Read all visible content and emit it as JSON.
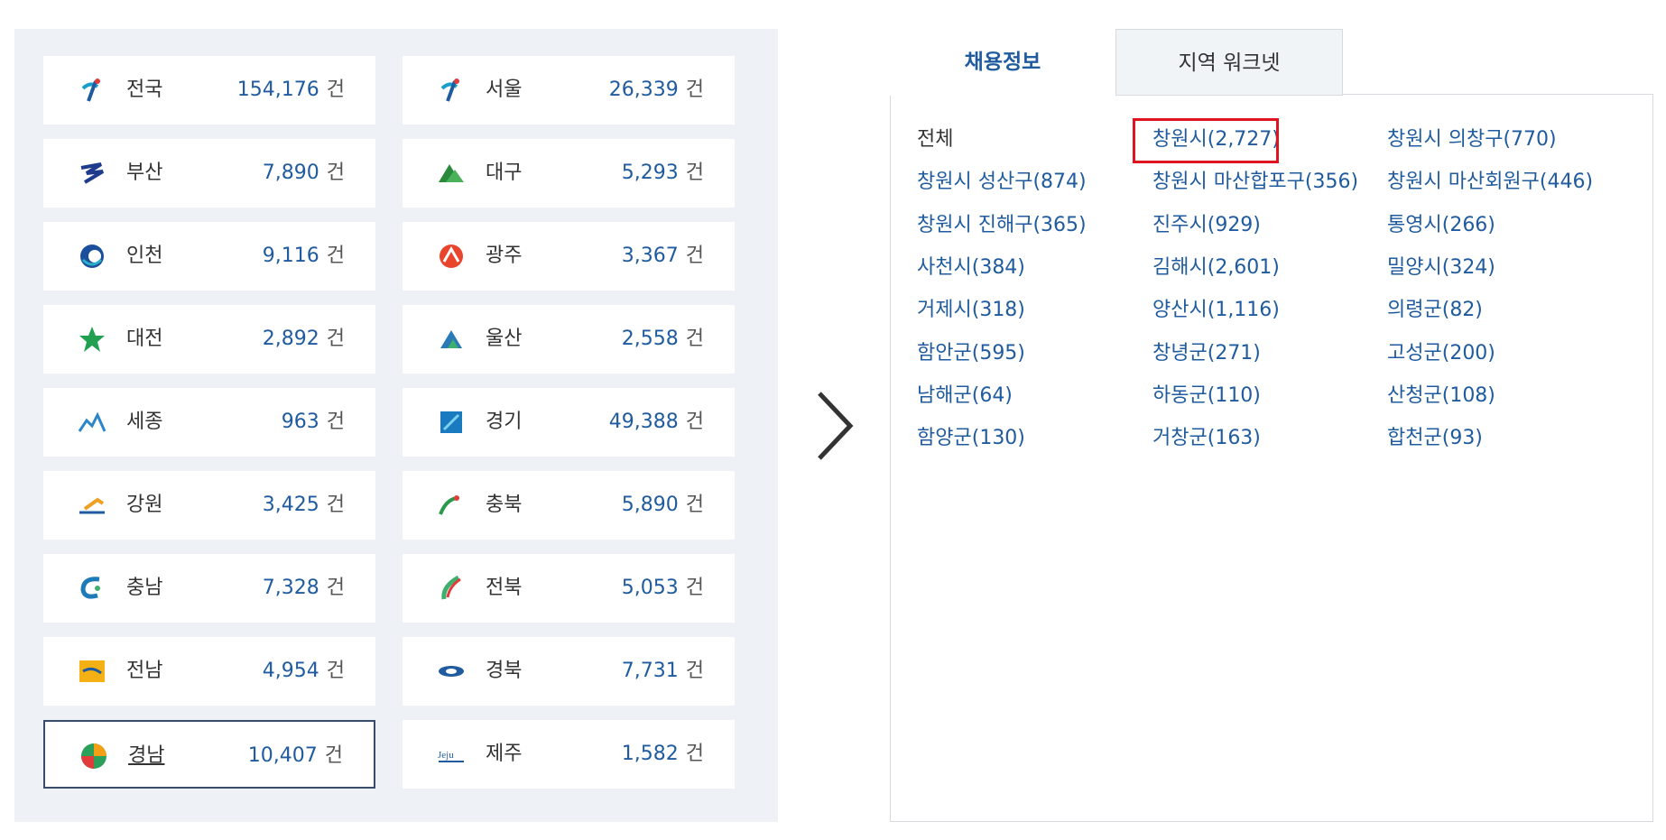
{
  "regions": [
    {
      "name": "전국",
      "count": "154,176",
      "unit": "건",
      "icon": "national-logo-icon"
    },
    {
      "name": "서울",
      "count": "26,339",
      "unit": "건",
      "icon": "seoul-logo-icon"
    },
    {
      "name": "부산",
      "count": "7,890",
      "unit": "건",
      "icon": "busan-logo-icon"
    },
    {
      "name": "대구",
      "count": "5,293",
      "unit": "건",
      "icon": "daegu-logo-icon"
    },
    {
      "name": "인천",
      "count": "9,116",
      "unit": "건",
      "icon": "incheon-logo-icon"
    },
    {
      "name": "광주",
      "count": "3,367",
      "unit": "건",
      "icon": "gwangju-logo-icon"
    },
    {
      "name": "대전",
      "count": "2,892",
      "unit": "건",
      "icon": "daejeon-logo-icon"
    },
    {
      "name": "울산",
      "count": "2,558",
      "unit": "건",
      "icon": "ulsan-logo-icon"
    },
    {
      "name": "세종",
      "count": "963",
      "unit": "건",
      "icon": "sejong-logo-icon"
    },
    {
      "name": "경기",
      "count": "49,388",
      "unit": "건",
      "icon": "gyeonggi-logo-icon"
    },
    {
      "name": "강원",
      "count": "3,425",
      "unit": "건",
      "icon": "gangwon-logo-icon"
    },
    {
      "name": "충북",
      "count": "5,890",
      "unit": "건",
      "icon": "chungbuk-logo-icon"
    },
    {
      "name": "충남",
      "count": "7,328",
      "unit": "건",
      "icon": "chungnam-logo-icon"
    },
    {
      "name": "전북",
      "count": "5,053",
      "unit": "건",
      "icon": "jeonbuk-logo-icon"
    },
    {
      "name": "전남",
      "count": "4,954",
      "unit": "건",
      "icon": "jeonnam-logo-icon"
    },
    {
      "name": "경북",
      "count": "7,731",
      "unit": "건",
      "icon": "gyeongbuk-logo-icon"
    },
    {
      "name": "경남",
      "count": "10,407",
      "unit": "건",
      "icon": "gyeongnam-logo-icon",
      "selected": true
    },
    {
      "name": "제주",
      "count": "1,582",
      "unit": "건",
      "icon": "jeju-logo-icon"
    }
  ],
  "tabs": {
    "active": "채용정보",
    "inactive": "지역 워크넷"
  },
  "cities": [
    {
      "name": "전체",
      "count": ""
    },
    {
      "name": "창원시",
      "count": "(2,727)",
      "highlighted": true
    },
    {
      "name": "창원시 의창구",
      "count": "(770)"
    },
    {
      "name": "창원시 성산구",
      "count": "(874)"
    },
    {
      "name": "창원시 마산합포구",
      "count": "(356)"
    },
    {
      "name": "창원시 마산회원구",
      "count": "(446)"
    },
    {
      "name": "창원시 진해구",
      "count": "(365)"
    },
    {
      "name": "진주시",
      "count": "(929)"
    },
    {
      "name": "통영시",
      "count": "(266)"
    },
    {
      "name": "사천시",
      "count": "(384)"
    },
    {
      "name": "김해시",
      "count": "(2,601)"
    },
    {
      "name": "밀양시",
      "count": "(324)"
    },
    {
      "name": "거제시",
      "count": "(318)"
    },
    {
      "name": "양산시",
      "count": "(1,116)"
    },
    {
      "name": "의령군",
      "count": "(82)"
    },
    {
      "name": "함안군",
      "count": "(595)"
    },
    {
      "name": "창녕군",
      "count": "(271)"
    },
    {
      "name": "고성군",
      "count": "(200)"
    },
    {
      "name": "남해군",
      "count": "(64)"
    },
    {
      "name": "하동군",
      "count": "(110)"
    },
    {
      "name": "산청군",
      "count": "(108)"
    },
    {
      "name": "함양군",
      "count": "(130)"
    },
    {
      "name": "거창군",
      "count": "(163)"
    },
    {
      "name": "합천군",
      "count": "(93)"
    }
  ],
  "colors": {
    "accent": "#1f5b9e",
    "highlight": "#e0141e",
    "panel_bg": "#eef1f5"
  },
  "arrow_icon": "chevron-right-icon"
}
